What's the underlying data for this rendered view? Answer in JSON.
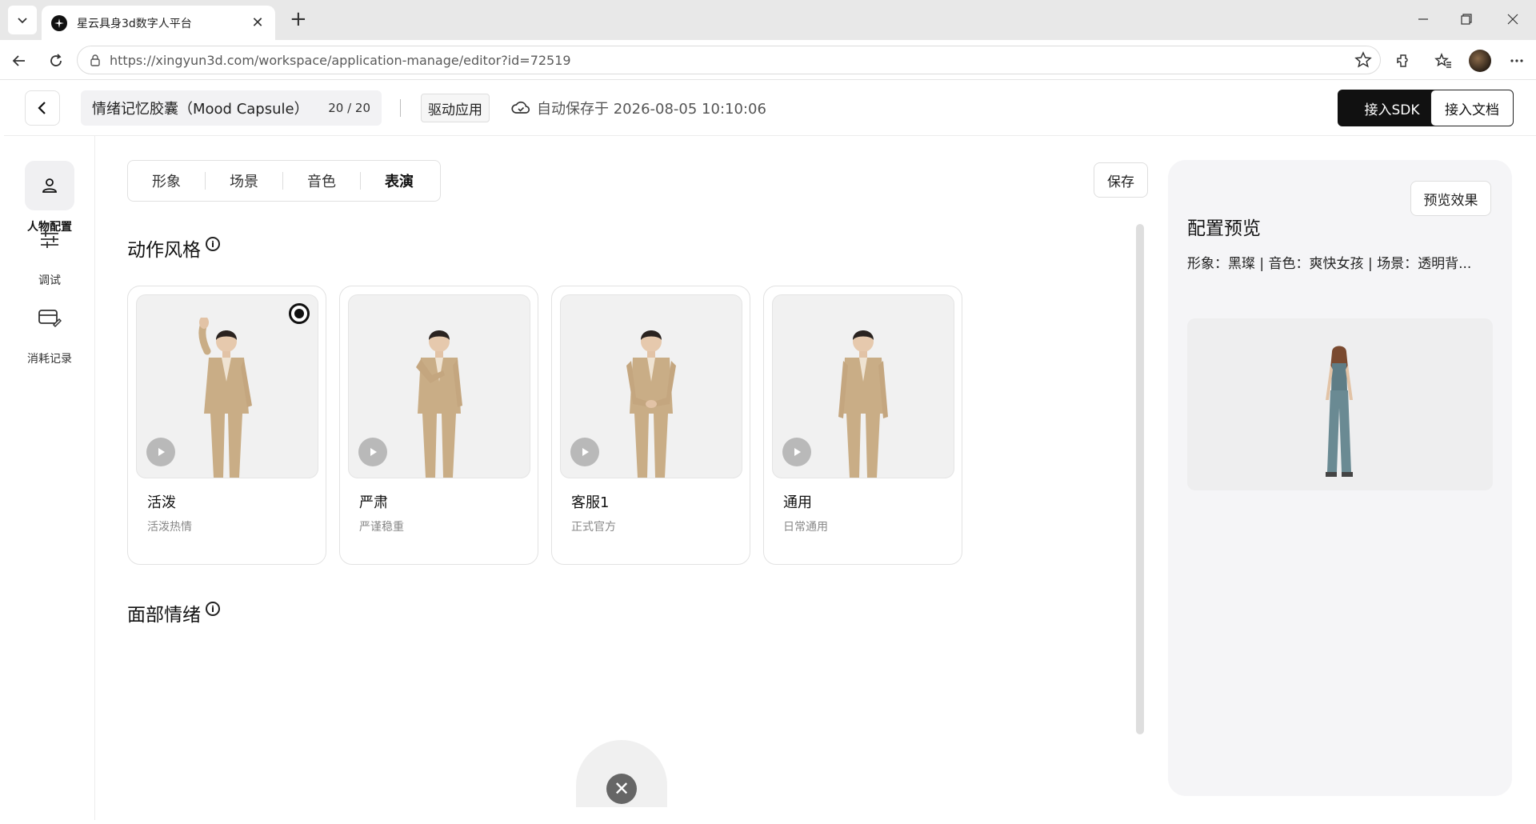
{
  "browser": {
    "tab_title": "星云具身3d数字人平台",
    "url": "https://xingyun3d.com/workspace/application-manage/editor?id=72519"
  },
  "header": {
    "app_name": "情绪记忆胶囊（Mood Capsule）",
    "name_count": "20 / 20",
    "drive_tag": "驱动应用",
    "autosave": "自动保存于 2026-08-05 10:10:06",
    "sdk_button": "接入SDK",
    "doc_button": "接入文档"
  },
  "rail": {
    "items": [
      {
        "label": "人物配置",
        "icon": "person-icon",
        "active": true
      },
      {
        "label": "调试",
        "icon": "sliders-icon",
        "active": false
      },
      {
        "label": "消耗记录",
        "icon": "card-edit-icon",
        "active": false
      }
    ]
  },
  "tabs": [
    {
      "label": "形象"
    },
    {
      "label": "场景"
    },
    {
      "label": "音色"
    },
    {
      "label": "表演",
      "active": true
    }
  ],
  "save_button": "保存",
  "sections": {
    "motion_style": "动作风格",
    "facial_emotion": "面部情绪"
  },
  "motion_cards": [
    {
      "name": "活泼",
      "desc": "活泼热情",
      "selected": true,
      "pose": "wave"
    },
    {
      "name": "严肃",
      "desc": "严谨稳重",
      "selected": false,
      "pose": "hand-chest"
    },
    {
      "name": "客服1",
      "desc": "正式官方",
      "selected": false,
      "pose": "hands-front"
    },
    {
      "name": "通用",
      "desc": "日常通用",
      "selected": false,
      "pose": "neutral"
    }
  ],
  "preview": {
    "button": "预览效果",
    "title": "配置预览",
    "meta": "形象：黑璨 | 音色：爽快女孩 | 场景：透明背..."
  },
  "colors": {
    "accent": "#111111",
    "suit": "#c9ad86",
    "panel_bg": "#f5f5f7"
  }
}
